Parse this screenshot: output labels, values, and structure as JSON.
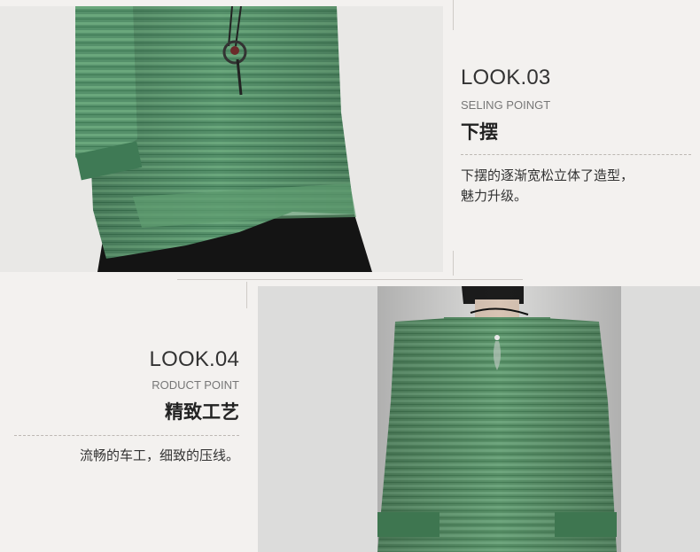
{
  "look03": {
    "title": "LOOK.03",
    "subtitle": "SELING POINGT",
    "heading": "下摆",
    "desc_line1": "下摆的逐渐宽松立体了造型，",
    "desc_line2": "魅力升级。"
  },
  "look04": {
    "title": "LOOK.04",
    "subtitle": "RODUCT POINT",
    "heading": "精致工艺",
    "desc": "流畅的车工，细致的压线。"
  },
  "colors": {
    "background": "#f3f1ef",
    "garment_green": "#4f8b60",
    "text_dark": "#333333"
  }
}
